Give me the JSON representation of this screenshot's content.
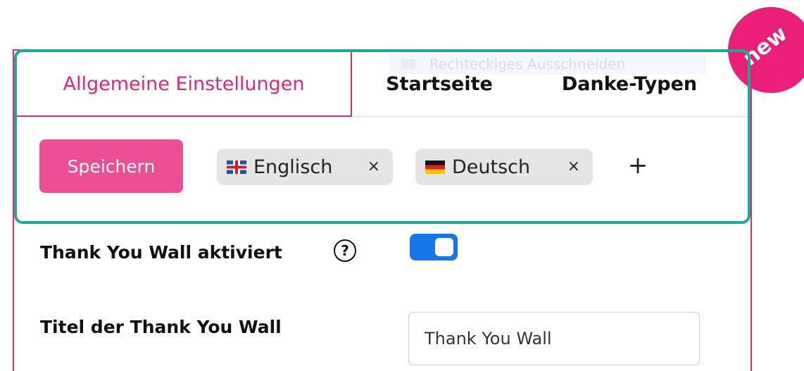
{
  "badge": {
    "label": "new"
  },
  "ghost": {
    "text": "Rechteckiges Ausschneiden"
  },
  "tabs": [
    {
      "label": "Allgemeine Einstellungen",
      "active": true
    },
    {
      "label": "Startseite",
      "active": false
    },
    {
      "label": "Danke-Typen",
      "active": false
    }
  ],
  "toolbar": {
    "save_label": "Speichern",
    "languages": [
      {
        "label": "Englisch",
        "flag": "uk-flag-icon",
        "remove": "×"
      },
      {
        "label": "Deutsch",
        "flag": "de-flag-icon",
        "remove": "×"
      }
    ],
    "add_label": "+"
  },
  "form": {
    "active_label": "Thank You Wall aktiviert",
    "help_glyph": "?",
    "active_enabled": true,
    "title_label": "Titel der Thank You Wall",
    "title_value": "Thank You Wall"
  },
  "colors": {
    "accent": "#e0267a",
    "panel_border": "#1fa796",
    "button": "#ec4f93",
    "toggle": "#1677e8",
    "badge": "#ea1f78"
  }
}
